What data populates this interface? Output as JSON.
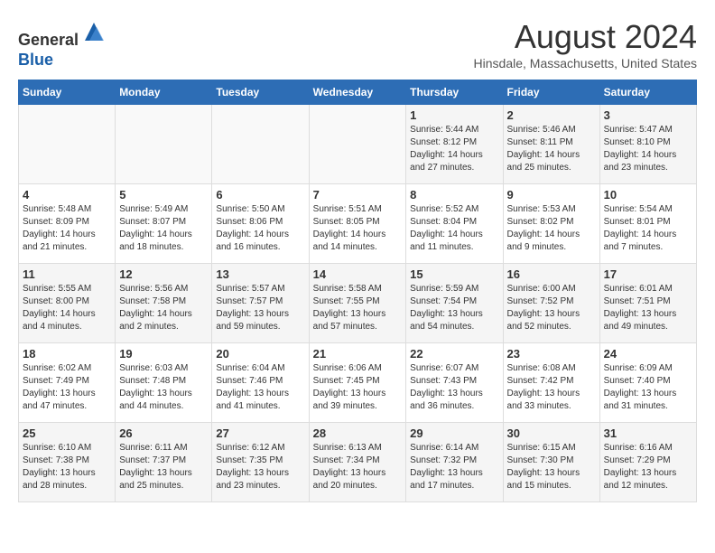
{
  "header": {
    "logo_line1": "General",
    "logo_line2": "Blue",
    "month_title": "August 2024",
    "location": "Hinsdale, Massachusetts, United States"
  },
  "weekdays": [
    "Sunday",
    "Monday",
    "Tuesday",
    "Wednesday",
    "Thursday",
    "Friday",
    "Saturday"
  ],
  "weeks": [
    [
      {
        "day": "",
        "info": ""
      },
      {
        "day": "",
        "info": ""
      },
      {
        "day": "",
        "info": ""
      },
      {
        "day": "",
        "info": ""
      },
      {
        "day": "1",
        "info": "Sunrise: 5:44 AM\nSunset: 8:12 PM\nDaylight: 14 hours\nand 27 minutes."
      },
      {
        "day": "2",
        "info": "Sunrise: 5:46 AM\nSunset: 8:11 PM\nDaylight: 14 hours\nand 25 minutes."
      },
      {
        "day": "3",
        "info": "Sunrise: 5:47 AM\nSunset: 8:10 PM\nDaylight: 14 hours\nand 23 minutes."
      }
    ],
    [
      {
        "day": "4",
        "info": "Sunrise: 5:48 AM\nSunset: 8:09 PM\nDaylight: 14 hours\nand 21 minutes."
      },
      {
        "day": "5",
        "info": "Sunrise: 5:49 AM\nSunset: 8:07 PM\nDaylight: 14 hours\nand 18 minutes."
      },
      {
        "day": "6",
        "info": "Sunrise: 5:50 AM\nSunset: 8:06 PM\nDaylight: 14 hours\nand 16 minutes."
      },
      {
        "day": "7",
        "info": "Sunrise: 5:51 AM\nSunset: 8:05 PM\nDaylight: 14 hours\nand 14 minutes."
      },
      {
        "day": "8",
        "info": "Sunrise: 5:52 AM\nSunset: 8:04 PM\nDaylight: 14 hours\nand 11 minutes."
      },
      {
        "day": "9",
        "info": "Sunrise: 5:53 AM\nSunset: 8:02 PM\nDaylight: 14 hours\nand 9 minutes."
      },
      {
        "day": "10",
        "info": "Sunrise: 5:54 AM\nSunset: 8:01 PM\nDaylight: 14 hours\nand 7 minutes."
      }
    ],
    [
      {
        "day": "11",
        "info": "Sunrise: 5:55 AM\nSunset: 8:00 PM\nDaylight: 14 hours\nand 4 minutes."
      },
      {
        "day": "12",
        "info": "Sunrise: 5:56 AM\nSunset: 7:58 PM\nDaylight: 14 hours\nand 2 minutes."
      },
      {
        "day": "13",
        "info": "Sunrise: 5:57 AM\nSunset: 7:57 PM\nDaylight: 13 hours\nand 59 minutes."
      },
      {
        "day": "14",
        "info": "Sunrise: 5:58 AM\nSunset: 7:55 PM\nDaylight: 13 hours\nand 57 minutes."
      },
      {
        "day": "15",
        "info": "Sunrise: 5:59 AM\nSunset: 7:54 PM\nDaylight: 13 hours\nand 54 minutes."
      },
      {
        "day": "16",
        "info": "Sunrise: 6:00 AM\nSunset: 7:52 PM\nDaylight: 13 hours\nand 52 minutes."
      },
      {
        "day": "17",
        "info": "Sunrise: 6:01 AM\nSunset: 7:51 PM\nDaylight: 13 hours\nand 49 minutes."
      }
    ],
    [
      {
        "day": "18",
        "info": "Sunrise: 6:02 AM\nSunset: 7:49 PM\nDaylight: 13 hours\nand 47 minutes."
      },
      {
        "day": "19",
        "info": "Sunrise: 6:03 AM\nSunset: 7:48 PM\nDaylight: 13 hours\nand 44 minutes."
      },
      {
        "day": "20",
        "info": "Sunrise: 6:04 AM\nSunset: 7:46 PM\nDaylight: 13 hours\nand 41 minutes."
      },
      {
        "day": "21",
        "info": "Sunrise: 6:06 AM\nSunset: 7:45 PM\nDaylight: 13 hours\nand 39 minutes."
      },
      {
        "day": "22",
        "info": "Sunrise: 6:07 AM\nSunset: 7:43 PM\nDaylight: 13 hours\nand 36 minutes."
      },
      {
        "day": "23",
        "info": "Sunrise: 6:08 AM\nSunset: 7:42 PM\nDaylight: 13 hours\nand 33 minutes."
      },
      {
        "day": "24",
        "info": "Sunrise: 6:09 AM\nSunset: 7:40 PM\nDaylight: 13 hours\nand 31 minutes."
      }
    ],
    [
      {
        "day": "25",
        "info": "Sunrise: 6:10 AM\nSunset: 7:38 PM\nDaylight: 13 hours\nand 28 minutes."
      },
      {
        "day": "26",
        "info": "Sunrise: 6:11 AM\nSunset: 7:37 PM\nDaylight: 13 hours\nand 25 minutes."
      },
      {
        "day": "27",
        "info": "Sunrise: 6:12 AM\nSunset: 7:35 PM\nDaylight: 13 hours\nand 23 minutes."
      },
      {
        "day": "28",
        "info": "Sunrise: 6:13 AM\nSunset: 7:34 PM\nDaylight: 13 hours\nand 20 minutes."
      },
      {
        "day": "29",
        "info": "Sunrise: 6:14 AM\nSunset: 7:32 PM\nDaylight: 13 hours\nand 17 minutes."
      },
      {
        "day": "30",
        "info": "Sunrise: 6:15 AM\nSunset: 7:30 PM\nDaylight: 13 hours\nand 15 minutes."
      },
      {
        "day": "31",
        "info": "Sunrise: 6:16 AM\nSunset: 7:29 PM\nDaylight: 13 hours\nand 12 minutes."
      }
    ]
  ]
}
